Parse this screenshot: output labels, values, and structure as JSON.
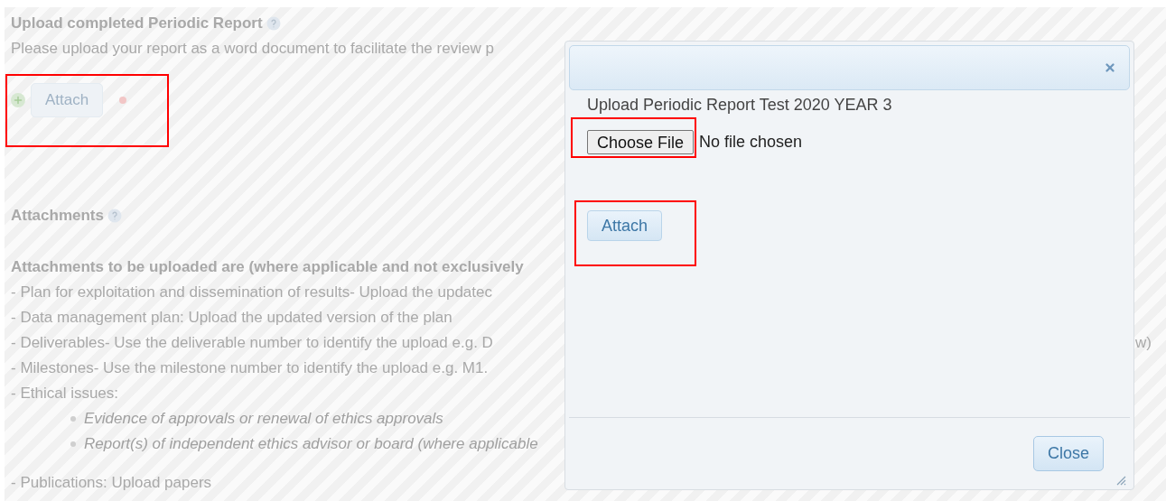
{
  "report_section": {
    "title": "Upload completed Periodic Report",
    "hint": "Please upload your report as a word document to facilitate the review p",
    "attach_button": "Attach"
  },
  "attachments_section": {
    "title": "Attachments",
    "intro": "Attachments to be uploaded are (where applicable and not exclusively",
    "lines": [
      {
        "text": "- Plan for exploitation and dissemination of results- Upload the updatec"
      },
      {
        "text": "- Data management plan: Upload the updated version of the plan"
      },
      {
        "text": "- Deliverables- Use the deliverable number to identify the upload e.g. D",
        "tail": "w)"
      },
      {
        "text": "- Milestones- Use the milestone number to identify the upload e.g. M1."
      },
      {
        "text": "- Ethical issues:"
      }
    ],
    "ethics_items": [
      "Evidence of approvals or renewal of ethics approvals",
      "Report(s) of independent ethics advisor or board (where applicable"
    ],
    "last_line": "- Publications: Upload papers"
  },
  "dialog": {
    "label": "Upload Periodic Report Test 2020 YEAR 3",
    "choose_file": "Choose File",
    "file_status": "No file chosen",
    "attach_button": "Attach",
    "close_button": "Close"
  }
}
